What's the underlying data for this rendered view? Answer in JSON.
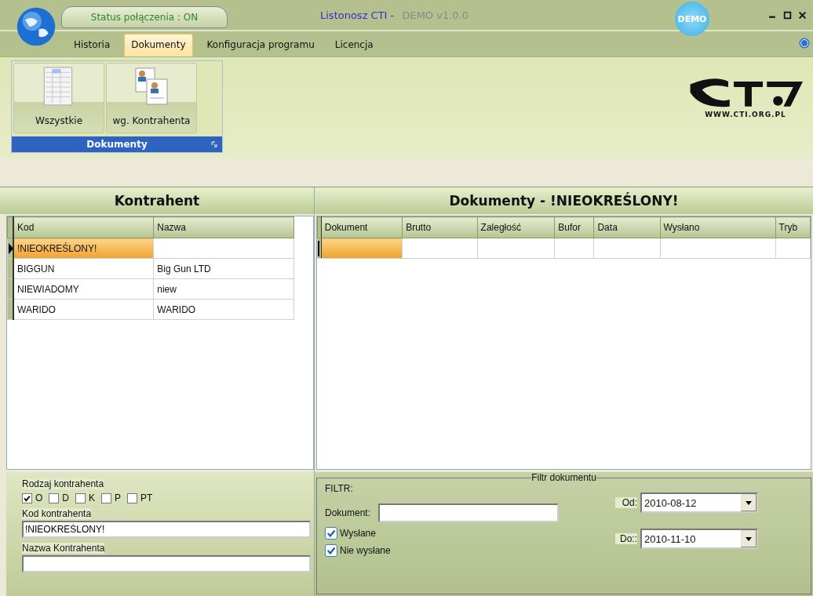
{
  "window": {
    "status": "Status połączenia : ON",
    "title": "Listonosz CTI -",
    "version": "DEMO v1.0.0",
    "badge": "DEMO"
  },
  "tabs": [
    {
      "label": "Historia",
      "selected": false
    },
    {
      "label": "Dokumenty",
      "selected": true
    },
    {
      "label": "Konfiguracja programu",
      "selected": false
    },
    {
      "label": "Licencja",
      "selected": false
    }
  ],
  "ribbon": {
    "group": "Dokumenty",
    "buttons": [
      {
        "label": "Wszystkie",
        "kind": "table"
      },
      {
        "label": "wg. Kontrahenta",
        "kind": "people"
      }
    ],
    "logo_url": "WWW.CTI.ORG.PL"
  },
  "left_panel": {
    "title": "Kontrahent",
    "columns": [
      "Kod",
      "Nazwa"
    ],
    "rows": [
      {
        "kod": "!NIEOKREŚLONY!",
        "selected": true
      },
      {
        "kod": "BIGGUN",
        "nazwa": "Big Gun LTD",
        "selected": false
      },
      {
        "kod": "NIEWIADOMY",
        "nazwa": "niew",
        "selected": false
      },
      {
        "kod": "WARIDO",
        "nazwa": "WARIDO",
        "selected": false
      }
    ],
    "type_label": "Rodzaj kontrahenta",
    "types": [
      {
        "label": "O",
        "checked": true
      },
      {
        "label": "D",
        "checked": false
      },
      {
        "label": "K",
        "checked": false
      },
      {
        "label": "P",
        "checked": false
      },
      {
        "label": "PT",
        "checked": false
      }
    ],
    "code_label": "Kod kontrahenta",
    "code_value": "!NIEOKREŚLONY!",
    "name_label": "Nazwa Kontrahenta"
  },
  "right_panel": {
    "title": "Dokumenty - !NIEOKREŚLONY!",
    "columns": [
      "Dokument",
      "Brutto",
      "Zaległość",
      "Bufor",
      "Data",
      "Wysłano",
      "Tryb"
    ],
    "rows": [
      {
        "selected": true
      }
    ],
    "filter": {
      "legend": "Filtr dokumentu",
      "heading": "FILTR:",
      "document_label": "Dokument:",
      "checks": [
        {
          "label": "Wysłane",
          "checked": true
        },
        {
          "label": "Nie wysłane",
          "checked": true
        }
      ],
      "dates": [
        {
          "label": "Od:",
          "value": "2010-08-12"
        },
        {
          "label": "Do::",
          "value": "2010-11-10"
        }
      ]
    }
  }
}
